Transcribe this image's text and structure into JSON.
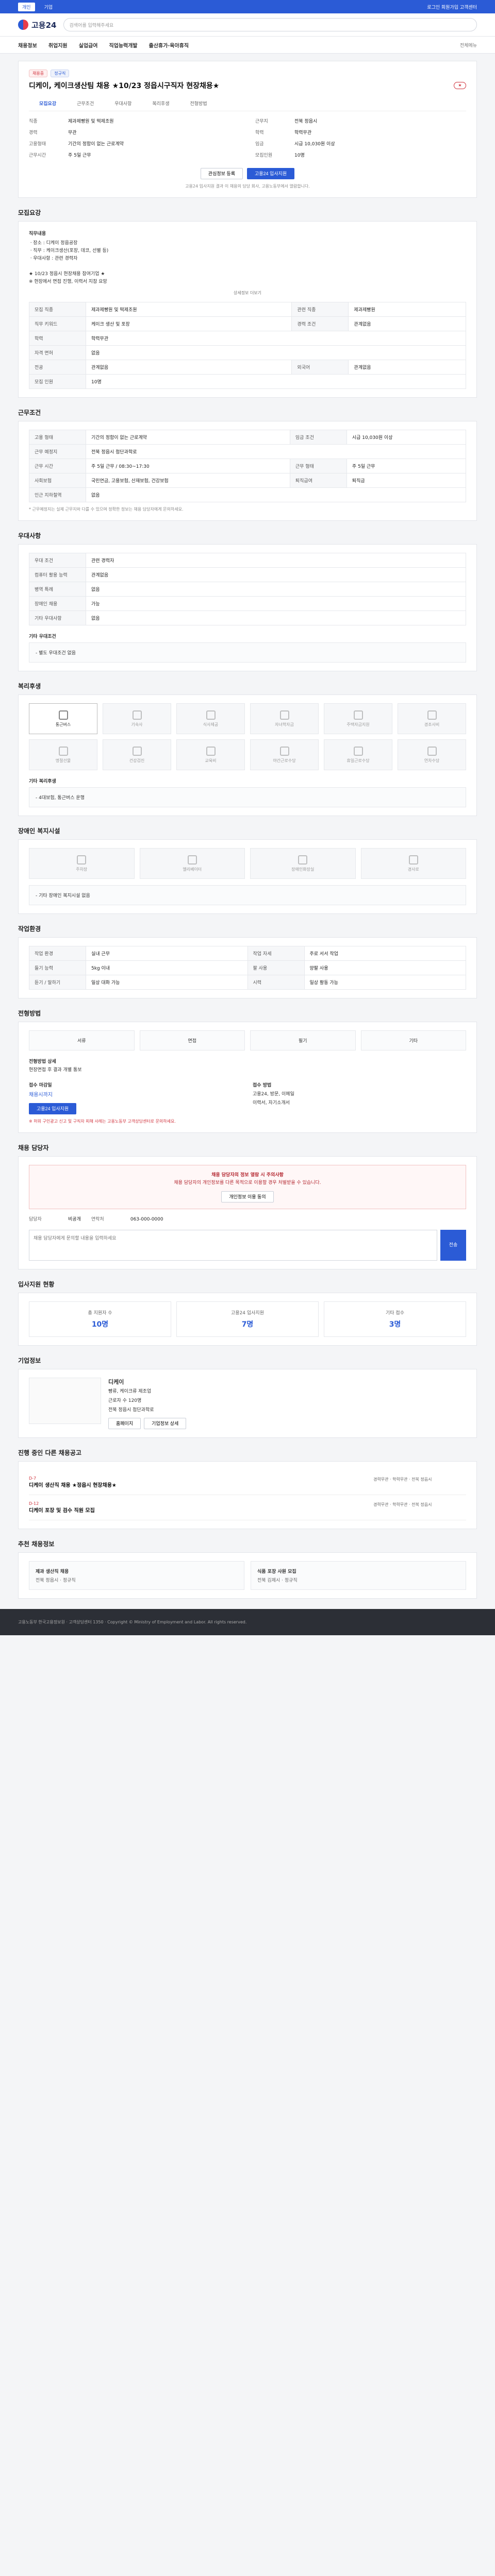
{
  "topbar": {
    "tabs": [
      "개인",
      "기업"
    ],
    "right": "로그인 회원가입 고객센터"
  },
  "header": {
    "logo": "고용24",
    "search_placeholder": "검색어를 입력해주세요"
  },
  "gnb": {
    "items": [
      "채용정보",
      "취업지원",
      "실업급여",
      "직업능력개발",
      "출산휴가·육아휴직"
    ],
    "right": "전체메뉴"
  },
  "job": {
    "tags": [
      "채용중",
      "정규직"
    ],
    "title": "디케이, 케이크생산팀 채용 ★10/23 정읍시구직자 현장채용★",
    "subtabs": [
      "모집요강",
      "근무조건",
      "우대사항",
      "복리후생",
      "전형방법"
    ],
    "summary": [
      [
        "직종",
        "제과제빵원 및 떡제조원"
      ],
      [
        "근무지",
        "전북 정읍시"
      ],
      [
        "경력",
        "무관"
      ],
      [
        "학력",
        "학력무관"
      ],
      [
        "고용형태",
        "기간의 정함이 없는 근로계약"
      ],
      [
        "임금",
        "시급 10,030원 이상"
      ],
      [
        "근무시간",
        "주 5일 근무"
      ],
      [
        "모집인원",
        "10명"
      ]
    ],
    "buttons": {
      "interest": "관심정보 등록",
      "apply": "고용24 입사지원"
    },
    "notice": "고용24 입사지원 결과 이 채용의 담당 회사, 고용노동부에서 열람합니다."
  },
  "section_titles": {
    "recruit": "모집요강",
    "conditions": "근무조건",
    "preference": "우대사항",
    "welfare": "복리후생",
    "disability": "장애인 복지시설",
    "workenv": "작업환경",
    "selection": "전형방법",
    "contact": "채용 담당자",
    "stats": "입사지원 현황",
    "company": "기업정보",
    "other": "진행 중인 다른 채용공고",
    "recommend": "추천 채용정보"
  },
  "recruit": {
    "duty_label": "직무내용",
    "duty": "ㆍ장소 : 디케이 정읍공장\nㆍ직무 : 케이크생산(포장, 데코, 선별 등)\nㆍ우대사항 : 관련 경력자\n\n★ 10/23 정읍시 현장채용 참여기업 ★\n※ 현장에서 면접 진행, 이력서 지참 요망",
    "more": "상세정보 더보기",
    "table": [
      [
        "모집 직종",
        "제과제빵원 및 떡제조원",
        "관련 직종",
        "제과제빵원"
      ],
      [
        "직무 키워드",
        "케이크 생산 및 포장",
        "경력 조건",
        "관계없음"
      ],
      [
        "학력",
        "학력무관",
        "",
        ""
      ],
      [
        "자격 면허",
        "없음",
        "",
        ""
      ],
      [
        "전공",
        "관계없음",
        "외국어",
        "관계없음"
      ],
      [
        "모집 인원",
        "10명",
        "",
        ""
      ]
    ]
  },
  "conditions": {
    "table": [
      [
        "고용 형태",
        "기간의 정함이 없는 근로계약",
        "임금 조건",
        "시급 10,030원 이상"
      ],
      [
        "근무 예정지",
        "전북 정읍시 첨단과학로",
        "",
        ""
      ],
      [
        "근무 시간",
        "주 5일 근무 / 08:30~17:30",
        "근무 형태",
        "주 5일 근무"
      ],
      [
        "사회보험",
        "국민연금, 고용보험, 산재보험, 건강보험",
        "퇴직급여",
        "퇴직금"
      ],
      [
        "인근 지하철역",
        "없음",
        "",
        ""
      ]
    ],
    "note": "* 근무예정지는 실제 근무지와 다를 수 있으며 정확한 정보는 채용 담당자에게 문의하세요."
  },
  "preference": {
    "table": [
      [
        "우대 조건",
        "관련 경력자"
      ],
      [
        "컴퓨터 활용 능력",
        "관계없음"
      ],
      [
        "병역 특례",
        "없음"
      ],
      [
        "장애인 채용",
        "가능"
      ],
      [
        "기타 우대사항",
        "없음"
      ]
    ],
    "extra_label": "기타 우대조건",
    "extra": "- 별도 우대조건 없음"
  },
  "welfare": {
    "icons": [
      "통근버스",
      "기숙사",
      "식사제공",
      "자녀학자금",
      "주택자금지원",
      "경조사비",
      "명절선물",
      "건강검진",
      "교육비",
      "야간근로수당",
      "휴일근로수당",
      "연차수당"
    ],
    "active_index": 0,
    "extra_label": "기타 복리후생",
    "extra": "- 4대보험, 통근버스 운행"
  },
  "disability": {
    "items": [
      "주차장",
      "엘리베이터",
      "장애인화장실",
      "경사로"
    ],
    "extra": "- 기타 장애인 복지시설 없음"
  },
  "workenv": {
    "table": [
      [
        "작업 환경",
        "실내 근무",
        "작업 자세",
        "주로 서서 작업"
      ],
      [
        "들기 능력",
        "5kg 이내",
        "팔 사용",
        "양팔 사용"
      ],
      [
        "듣기 / 말하기",
        "일상 대화 가능",
        "시력",
        "일상 활동 가능"
      ]
    ]
  },
  "selection": {
    "steps": [
      "서류",
      "면접",
      "필기",
      "기타"
    ],
    "method_label": "전형방법 상세",
    "method": "현장면접 후 결과 개별 통보",
    "deadline_label": "접수 마감일",
    "deadline": "채용시까지",
    "apply_label": "접수 방법",
    "apply": "고용24, 방문, 이메일",
    "submit_docs": "이력서, 자기소개서",
    "notice": "※ 허위 구인광고 신고 및 구직자 피해 사례는 고용노동부 고객상담센터로 문의하세요."
  },
  "contact": {
    "warning_title": "채용 담당자의 정보 열람 시 주의사항",
    "warning": "채용 담당자의 개인정보를 다른 목적으로 이용할 경우 처벌받을 수 있습니다.",
    "agree_label": "개인정보 이용 동의",
    "name_label": "담당자",
    "name": "비공개",
    "phone_label": "연락처",
    "phone": "063-000-0000",
    "message_placeholder": "채용 담당자에게 문의할 내용을 입력하세요",
    "send": "전송"
  },
  "stats": [
    {
      "label": "총 지원자 수",
      "value": "10명"
    },
    {
      "label": "고용24 입사지원",
      "value": "7명"
    },
    {
      "label": "기타 접수",
      "value": "3명"
    }
  ],
  "company": {
    "name": "디케이",
    "industry": "빵류, 케이크류 제조업",
    "employees": "근로자 수 120명",
    "address": "전북 정읍시 첨단과학로",
    "buttons": [
      "홈페이지",
      "기업정보 상세"
    ]
  },
  "other_jobs": [
    {
      "title": "디케이 생산직 채용 ★정읍시 현장채용★",
      "deadline": "D-7",
      "info": "경력무관 · 학력무관 · 전북 정읍시"
    },
    {
      "title": "디케이 포장 및 검수 직원 모집",
      "deadline": "D-12",
      "info": "경력무관 · 학력무관 · 전북 정읍시"
    }
  ],
  "recommend": [
    {
      "title": "제과 생산직 채용",
      "info": "전북 정읍시 · 정규직"
    },
    {
      "title": "식품 포장 사원 모집",
      "info": "전북 김제시 · 정규직"
    }
  ],
  "footer": {
    "text": "고용노동부 한국고용정보원 · 고객상담센터 1350 · Copyright © Ministry of Employment and Labor. All rights reserved."
  }
}
